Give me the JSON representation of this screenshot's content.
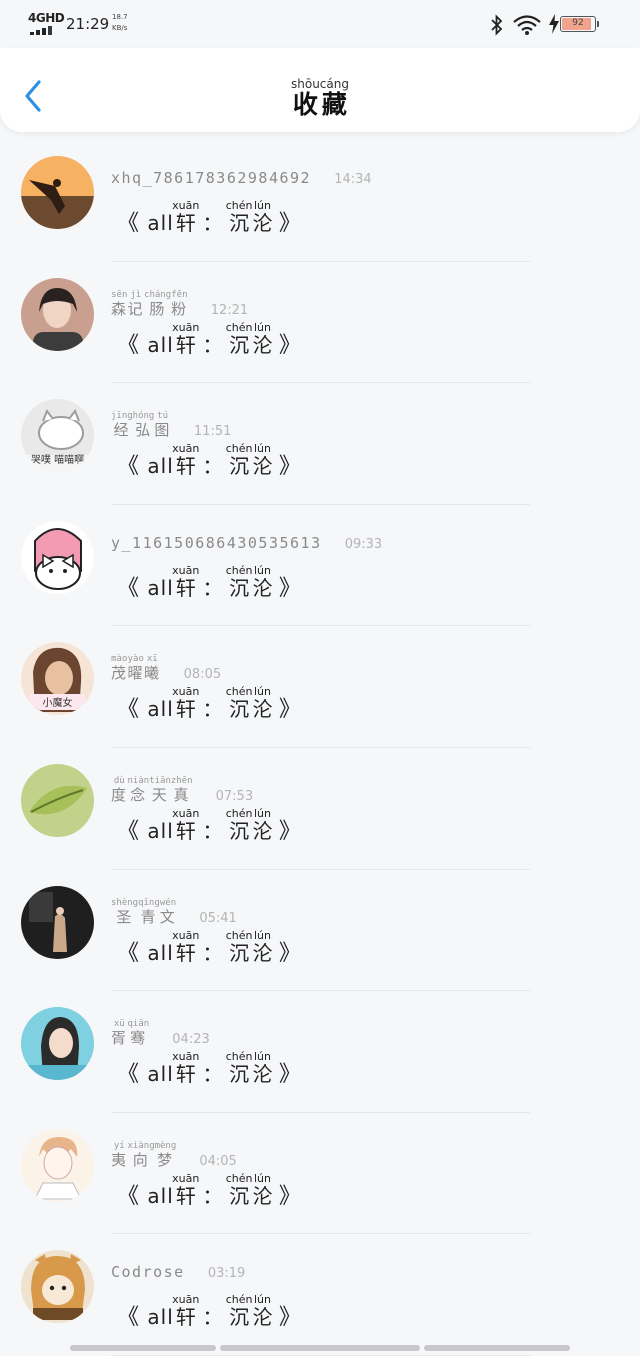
{
  "status_bar": {
    "network": "4GHD",
    "time": "21:29",
    "speed_value": "18.7",
    "speed_unit": "KB/s",
    "battery": "92",
    "battery_level": 0.92
  },
  "header": {
    "title_chars": [
      {
        "char": "收",
        "pinyin": "shōu"
      },
      {
        "char": "藏",
        "pinyin": "cáng"
      }
    ]
  },
  "items": [
    {
      "username": "xhq_786178362984692",
      "username_chars": [],
      "time": "14:34",
      "avatar_colors": [
        "#f6b162",
        "#6b4a2f"
      ],
      "avatar_icon": "sunset-person-icon"
    },
    {
      "username": "",
      "username_chars": [
        {
          "char": "森",
          "pinyin": "sēn"
        },
        {
          "char": "记",
          "pinyin": "jì"
        },
        {
          "char": "肠",
          "pinyin": "cháng"
        },
        {
          "char": "粉",
          "pinyin": "fěn"
        }
      ],
      "time": "12:21",
      "avatar_colors": [
        "#c9a08f",
        "#3c3c3c"
      ],
      "avatar_icon": "woman-portrait-icon"
    },
    {
      "username": "",
      "username_chars": [
        {
          "char": "经",
          "pinyin": "jīng"
        },
        {
          "char": "弘",
          "pinyin": "hóng"
        },
        {
          "char": "图",
          "pinyin": "tú"
        }
      ],
      "time": "11:51",
      "avatar_colors": [
        "#e9e9e9",
        "#9d9d9d"
      ],
      "avatar_icon": "cartoon-cat-icon",
      "avatar_text": "哭噗 喵喵啊"
    },
    {
      "username": "y_116150686430535613",
      "username_chars": [],
      "time": "09:33",
      "avatar_colors": [
        "#ffffff",
        "#f29bb3"
      ],
      "avatar_icon": "my-melody-icon"
    },
    {
      "username": "",
      "username_chars": [
        {
          "char": "茂",
          "pinyin": "mào"
        },
        {
          "char": "曜",
          "pinyin": "yào"
        },
        {
          "char": "曦",
          "pinyin": "xī"
        }
      ],
      "time": "08:05",
      "avatar_colors": [
        "#e8c2a0",
        "#6b4530"
      ],
      "avatar_icon": "girl-portrait-icon",
      "avatar_text": "小魔女"
    },
    {
      "username": "",
      "username_chars": [
        {
          "char": "度",
          "pinyin": "dù"
        },
        {
          "char": "念",
          "pinyin": "niàn"
        },
        {
          "char": "天",
          "pinyin": "tiān"
        },
        {
          "char": "真",
          "pinyin": "zhēn"
        }
      ],
      "time": "07:53",
      "avatar_colors": [
        "#a8c05a",
        "#5f7a2a"
      ],
      "avatar_icon": "leaf-icon"
    },
    {
      "username": "",
      "username_chars": [
        {
          "char": "圣",
          "pinyin": "shèng"
        },
        {
          "char": "青",
          "pinyin": "qīng"
        },
        {
          "char": "文",
          "pinyin": "wén"
        }
      ],
      "time": "05:41",
      "avatar_colors": [
        "#1f1f1f",
        "#c9a98a"
      ],
      "avatar_icon": "woman-doorway-icon"
    },
    {
      "username": "",
      "username_chars": [
        {
          "char": "胥",
          "pinyin": "xū"
        },
        {
          "char": "骞",
          "pinyin": "qiān"
        }
      ],
      "time": "04:23",
      "avatar_colors": [
        "#7fd0e0",
        "#2b2b2b"
      ],
      "avatar_icon": "girl-blue-icon"
    },
    {
      "username": "",
      "username_chars": [
        {
          "char": "夷",
          "pinyin": "yí"
        },
        {
          "char": "向",
          "pinyin": "xiàng"
        },
        {
          "char": "梦",
          "pinyin": "mèng"
        }
      ],
      "time": "04:05",
      "avatar_colors": [
        "#fbf3e8",
        "#e8b48a"
      ],
      "avatar_icon": "anime-boy-icon"
    },
    {
      "username": "Codrose",
      "username_chars": [],
      "time": "03:19",
      "avatar_colors": [
        "#d89a4a",
        "#6f4a26"
      ],
      "avatar_icon": "cat-costume-icon"
    }
  ],
  "content": {
    "open_quote": "《",
    "latin": "all",
    "char1": {
      "char": "轩",
      "pinyin": "xuān"
    },
    "colon": "：",
    "char2": {
      "char": "沉",
      "pinyin": "chén"
    },
    "char3": {
      "char": "沦",
      "pinyin": "lún"
    },
    "close_quote": "》"
  }
}
